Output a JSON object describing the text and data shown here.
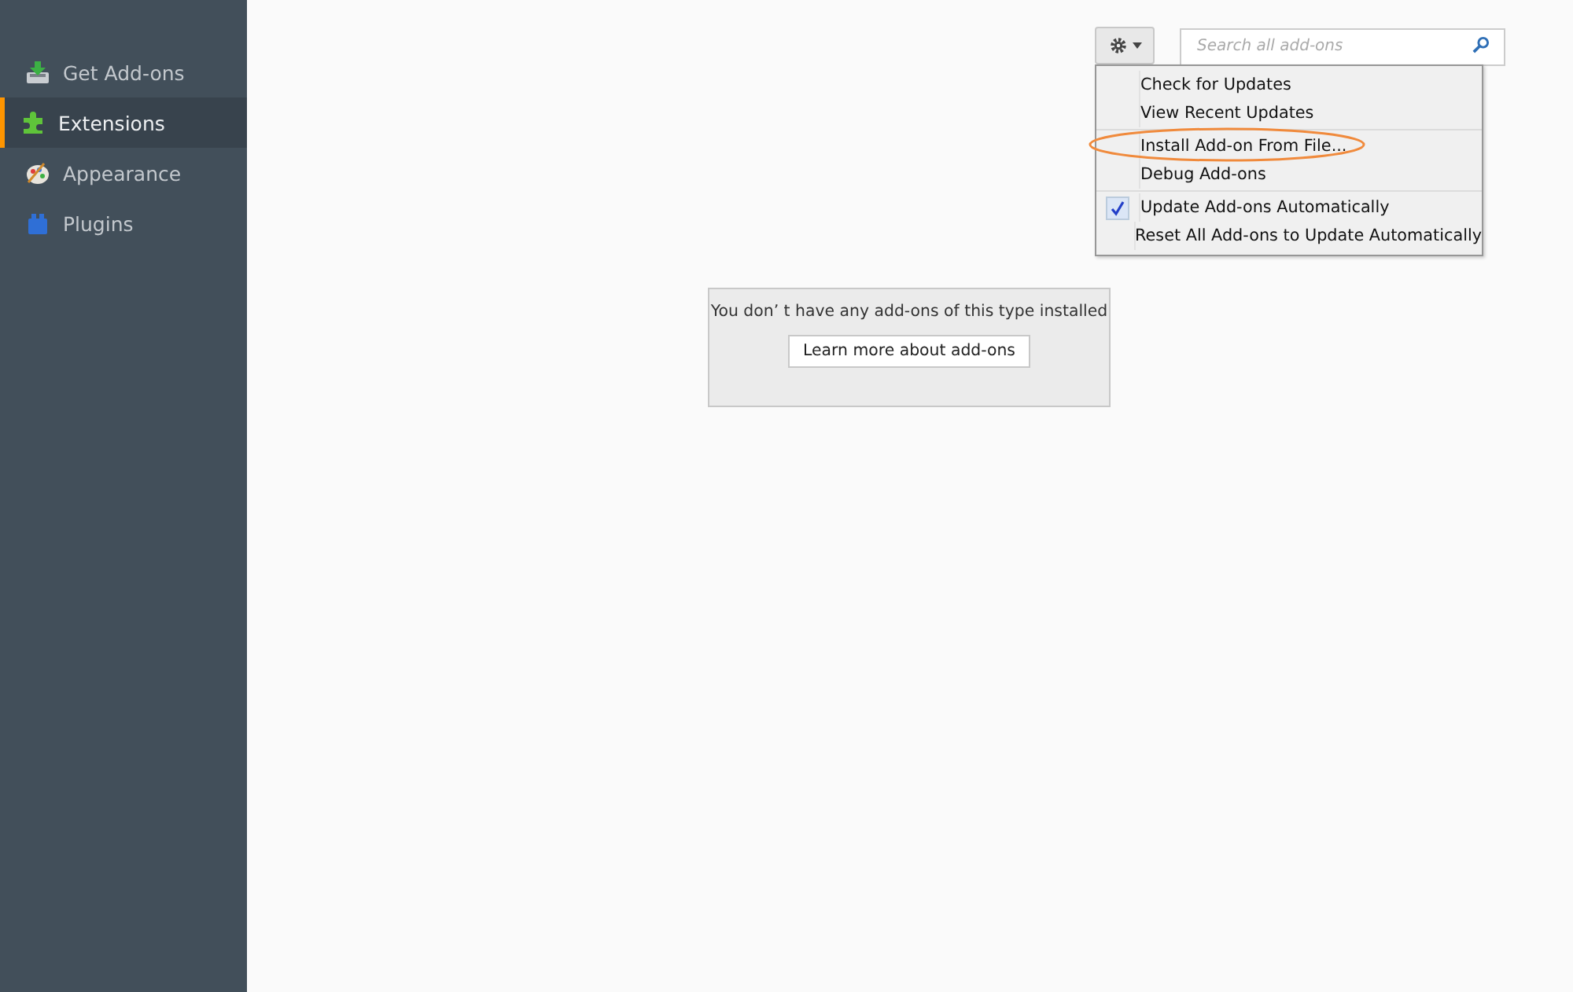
{
  "sidebar": {
    "items": [
      {
        "label": "Get Add-ons",
        "kind": "get",
        "selected": false
      },
      {
        "label": "Extensions",
        "kind": "extensions",
        "selected": true
      },
      {
        "label": "Appearance",
        "kind": "appearance",
        "selected": false
      },
      {
        "label": "Plugins",
        "kind": "plugins",
        "selected": false
      }
    ]
  },
  "toolbar": {
    "search": {
      "placeholder": "Search all add-ons"
    }
  },
  "menu": {
    "groups": [
      [
        {
          "label": "Check for Updates",
          "checked": false,
          "highlighted": false
        },
        {
          "label": "View Recent Updates",
          "checked": false,
          "highlighted": false
        }
      ],
      [
        {
          "label": "Install Add-on From File...",
          "checked": false,
          "highlighted": true
        },
        {
          "label": "Debug Add-ons",
          "checked": false,
          "highlighted": false
        }
      ],
      [
        {
          "label": "Update Add-ons Automatically",
          "checked": true,
          "highlighted": false
        },
        {
          "label": "Reset All Add-ons to Update Automatically",
          "checked": false,
          "highlighted": false
        }
      ]
    ]
  },
  "empty_notice": {
    "message": "You don’  t have any add-ons of this type installed",
    "button": "Learn more about add-ons"
  }
}
